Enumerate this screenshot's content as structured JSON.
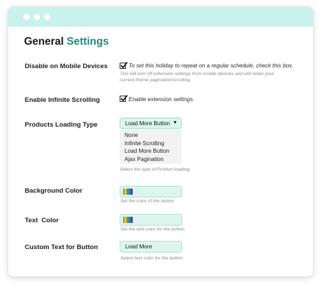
{
  "page": {
    "title_part1": "General",
    "title_part2": "Settings",
    "colors": {
      "accent": "#1f8a7a",
      "titlebar": "#c9f3ea",
      "field_bg": "#dcf6ee"
    }
  },
  "settings": {
    "mobile": {
      "label": "Disable on Mobile Devices",
      "checked": true,
      "checkbox_text": "To set this holiday to repeat on a regular schedule, check this box.",
      "help_line1": "This will turn off extension settings from mobile devices and will retain your",
      "help_line2": "current theme pagination/scrolling."
    },
    "infinite": {
      "label": "Enable Infinite Scrolling",
      "checked": true,
      "checkbox_text": "Enable extension settings."
    },
    "loading": {
      "label": "Products Loading Type",
      "selected": "Load More Button",
      "options": [
        "None",
        "Infinite Scrolling",
        "Load More Button",
        "Ajax Pagination"
      ],
      "help": "Select the type of Product loading."
    },
    "bg_color": {
      "label": "Background Color",
      "help": "Set the color of the button"
    },
    "text_color": {
      "label": "Text  Color",
      "help": "Set the text color for the button."
    },
    "custom_text": {
      "label": "Custom Text for Button",
      "value": "Load More",
      "help": "Select text color for the button."
    }
  }
}
